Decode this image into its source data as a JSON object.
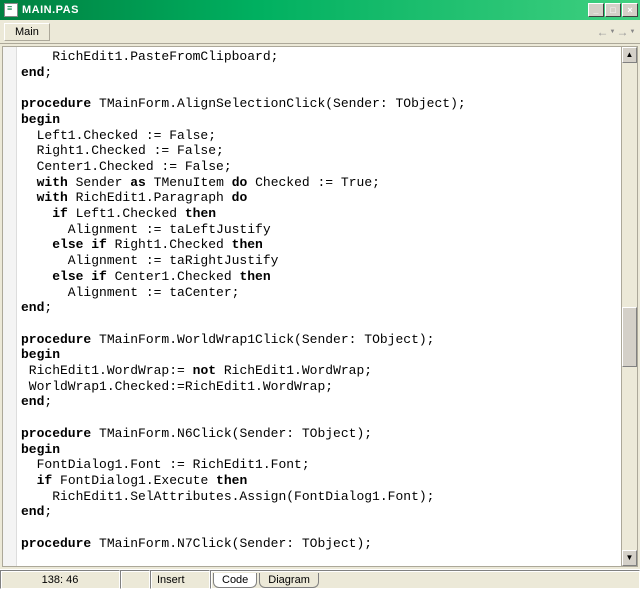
{
  "window": {
    "title": "MAIN.PAS"
  },
  "toolbar": {
    "tab": "Main"
  },
  "code_lines": [
    [
      [
        "    RichEdit1.PasteFromClipboard;",
        false
      ]
    ],
    [
      [
        "end",
        true
      ],
      [
        ";",
        false
      ]
    ],
    [
      [
        "",
        false
      ]
    ],
    [
      [
        "procedure",
        true
      ],
      [
        " TMainForm.AlignSelectionClick(Sender: TObject);",
        false
      ]
    ],
    [
      [
        "begin",
        true
      ]
    ],
    [
      [
        "  Left1.Checked := False;",
        false
      ]
    ],
    [
      [
        "  Right1.Checked := False;",
        false
      ]
    ],
    [
      [
        "  Center1.Checked := False;",
        false
      ]
    ],
    [
      [
        "  ",
        false
      ],
      [
        "with",
        true
      ],
      [
        " Sender ",
        false
      ],
      [
        "as",
        true
      ],
      [
        " TMenuItem ",
        false
      ],
      [
        "do",
        true
      ],
      [
        " Checked := True;",
        false
      ]
    ],
    [
      [
        "  ",
        false
      ],
      [
        "with",
        true
      ],
      [
        " RichEdit1.Paragraph ",
        false
      ],
      [
        "do",
        true
      ]
    ],
    [
      [
        "    ",
        false
      ],
      [
        "if",
        true
      ],
      [
        " Left1.Checked ",
        false
      ],
      [
        "then",
        true
      ]
    ],
    [
      [
        "      Alignment := taLeftJustify",
        false
      ]
    ],
    [
      [
        "    ",
        false
      ],
      [
        "else if",
        true
      ],
      [
        " Right1.Checked ",
        false
      ],
      [
        "then",
        true
      ]
    ],
    [
      [
        "      Alignment := taRightJustify",
        false
      ]
    ],
    [
      [
        "    ",
        false
      ],
      [
        "else if",
        true
      ],
      [
        " Center1.Checked ",
        false
      ],
      [
        "then",
        true
      ]
    ],
    [
      [
        "      Alignment := taCenter;",
        false
      ]
    ],
    [
      [
        "end",
        true
      ],
      [
        ";",
        false
      ]
    ],
    [
      [
        "",
        false
      ]
    ],
    [
      [
        "procedure",
        true
      ],
      [
        " TMainForm.WorldWrap1Click(Sender: TObject);",
        false
      ]
    ],
    [
      [
        "begin",
        true
      ]
    ],
    [
      [
        " RichEdit1.WordWrap:= ",
        false
      ],
      [
        "not",
        true
      ],
      [
        " RichEdit1.WordWrap;",
        false
      ]
    ],
    [
      [
        " WorldWrap1.Checked:=RichEdit1.WordWrap;",
        false
      ]
    ],
    [
      [
        "end",
        true
      ],
      [
        ";",
        false
      ]
    ],
    [
      [
        "",
        false
      ]
    ],
    [
      [
        "procedure",
        true
      ],
      [
        " TMainForm.N6Click(Sender: TObject);",
        false
      ]
    ],
    [
      [
        "begin",
        true
      ]
    ],
    [
      [
        "  FontDialog1.Font := RichEdit1.Font;",
        false
      ]
    ],
    [
      [
        "  ",
        false
      ],
      [
        "if",
        true
      ],
      [
        " FontDialog1.Execute ",
        false
      ],
      [
        "then",
        true
      ]
    ],
    [
      [
        "    RichEdit1.SelAttributes.Assign(FontDialog1.Font);",
        false
      ]
    ],
    [
      [
        "end",
        true
      ],
      [
        ";",
        false
      ]
    ],
    [
      [
        "",
        false
      ]
    ],
    [
      [
        "procedure",
        true
      ],
      [
        " TMainForm.N7Click(Sender: TObject);",
        false
      ]
    ]
  ],
  "status": {
    "position": "138: 46",
    "mode": "Insert",
    "tab_code": "Code",
    "tab_diagram": "Diagram"
  },
  "nav": {
    "back": "←",
    "forward": "→"
  },
  "winbuttons": {
    "min": "_",
    "max": "□",
    "close": "×"
  }
}
